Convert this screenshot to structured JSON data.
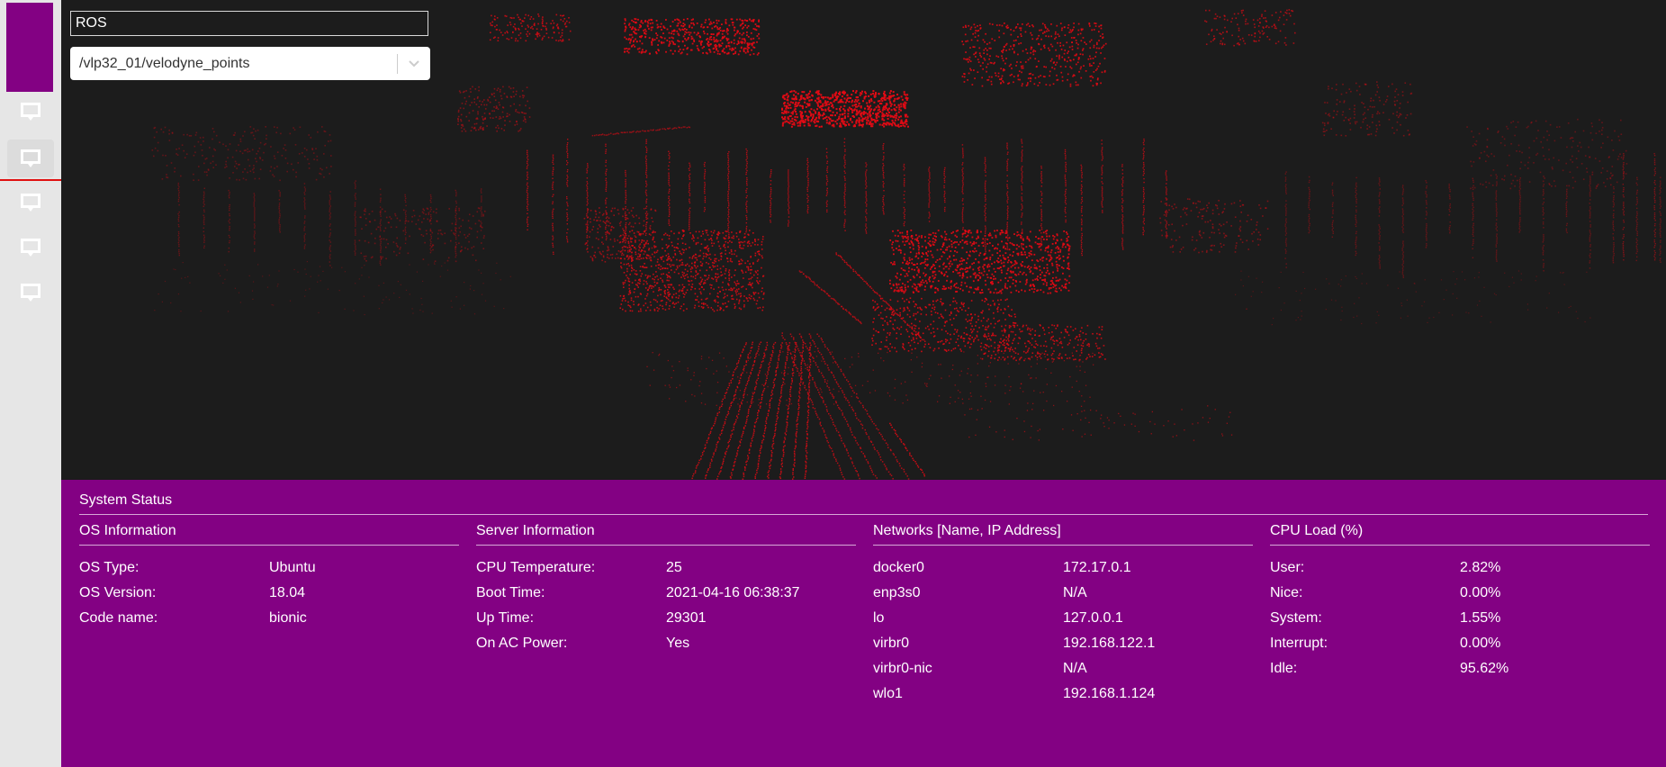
{
  "viewer": {
    "title": "ROS",
    "topic": {
      "selected": "/vlp32_01/velodyne_points"
    },
    "point_color": "#e10a14",
    "background_color": "#1c1c1c"
  },
  "sidebar": {
    "accent_color": "#830183",
    "items": [
      {
        "icon": "inbox-icon"
      },
      {
        "icon": "inbox-icon",
        "active": true
      },
      {
        "icon": "inbox-icon"
      },
      {
        "icon": "inbox-icon"
      },
      {
        "icon": "inbox-icon"
      }
    ]
  },
  "status": {
    "title": "System Status",
    "os": {
      "title": "OS Information",
      "rows": [
        {
          "label": "OS Type:",
          "value": "Ubuntu"
        },
        {
          "label": "OS Version:",
          "value": "18.04"
        },
        {
          "label": "Code name:",
          "value": "bionic"
        }
      ]
    },
    "server": {
      "title": "Server Information",
      "rows": [
        {
          "label": "CPU Temperature:",
          "value": "25"
        },
        {
          "label": "Boot Time:",
          "value": "2021-04-16 06:38:37"
        },
        {
          "label": "Up Time:",
          "value": "29301"
        },
        {
          "label": "On AC Power:",
          "value": "Yes"
        }
      ]
    },
    "networks": {
      "title": "Networks [Name, IP Address]",
      "rows": [
        {
          "label": "docker0",
          "value": "172.17.0.1"
        },
        {
          "label": "enp3s0",
          "value": "N/A"
        },
        {
          "label": "lo",
          "value": "127.0.0.1"
        },
        {
          "label": "virbr0",
          "value": "192.168.122.1"
        },
        {
          "label": "virbr0-nic",
          "value": "N/A"
        },
        {
          "label": "wlo1",
          "value": "192.168.1.124"
        }
      ]
    },
    "cpu": {
      "title": "CPU Load (%)",
      "rows": [
        {
          "label": "User:",
          "value": "2.82%"
        },
        {
          "label": "Nice:",
          "value": "0.00%"
        },
        {
          "label": "System:",
          "value": "1.55%"
        },
        {
          "label": "Interrupt:",
          "value": "0.00%"
        },
        {
          "label": "Idle:",
          "value": "95.62%"
        }
      ]
    }
  }
}
